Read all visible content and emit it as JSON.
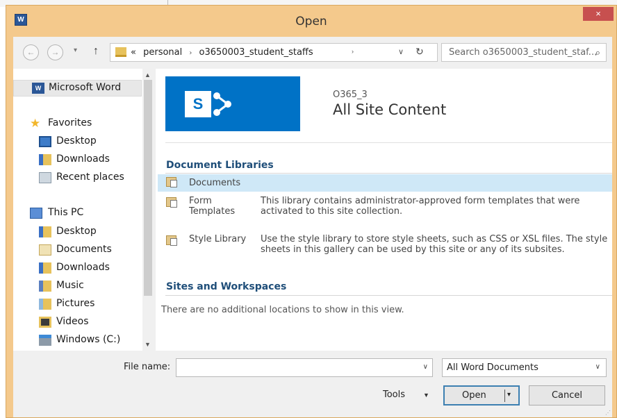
{
  "window": {
    "title": "Open",
    "app_icon": "W",
    "close": "×"
  },
  "nav": {
    "back": "←",
    "forward": "→",
    "recent": "▾",
    "up": "↑",
    "address": {
      "chevrons": "«",
      "seg1": "personal",
      "sep": "›",
      "seg2": "o3650003_student_staffs",
      "arrow": "›",
      "dropdown": "∨",
      "refresh": "↻"
    },
    "search_placeholder": "Search o3650003_student_staf...",
    "search_icon": "⌕"
  },
  "navpane": {
    "items": [
      {
        "label": "Microsoft Word",
        "icon": "word-icon"
      },
      {
        "label": "Favorites",
        "icon": "star-icon"
      },
      {
        "label": "Desktop",
        "icon": "desktop-icon"
      },
      {
        "label": "Downloads",
        "icon": "downloads-icon"
      },
      {
        "label": "Recent places",
        "icon": "recent-places-icon"
      },
      {
        "label": "This PC",
        "icon": "computer-icon"
      },
      {
        "label": "Desktop",
        "icon": "desktop-icon"
      },
      {
        "label": "Documents",
        "icon": "documents-icon"
      },
      {
        "label": "Downloads",
        "icon": "downloads-icon"
      },
      {
        "label": "Music",
        "icon": "music-icon"
      },
      {
        "label": "Pictures",
        "icon": "pictures-icon"
      },
      {
        "label": "Videos",
        "icon": "videos-icon"
      },
      {
        "label": "Windows (C:)",
        "icon": "drive-icon"
      }
    ],
    "word_icon_text": "W",
    "star": "★",
    "scroll_up": "▲",
    "scroll_down": "▼"
  },
  "content": {
    "logo_letter": "S",
    "site_code": "O365_3",
    "site_title": "All Site Content",
    "doc_libraries_title": "Document Libraries",
    "libraries": [
      {
        "name": "Documents",
        "desc": ""
      },
      {
        "name": "Form Templates",
        "desc": "This library contains administrator-approved form templates that were activated to this site collection."
      },
      {
        "name": "Style Library",
        "desc": "Use the style library to store style sheets, such as CSS or XSL files. The style sheets in this gallery can be used by this site or any of its subsites."
      }
    ],
    "sites_title": "Sites and Workspaces",
    "empty_message": "There are no additional locations to show in this view."
  },
  "bottom": {
    "file_name_label": "File name:",
    "file_name_value": "",
    "file_type": "All Word Documents",
    "dropdown_glyph": "∨",
    "tools_label": "Tools",
    "tools_dd": "▼",
    "open_label": "Open",
    "open_dd": "▾",
    "cancel_label": "Cancel",
    "grip": "⋰"
  }
}
